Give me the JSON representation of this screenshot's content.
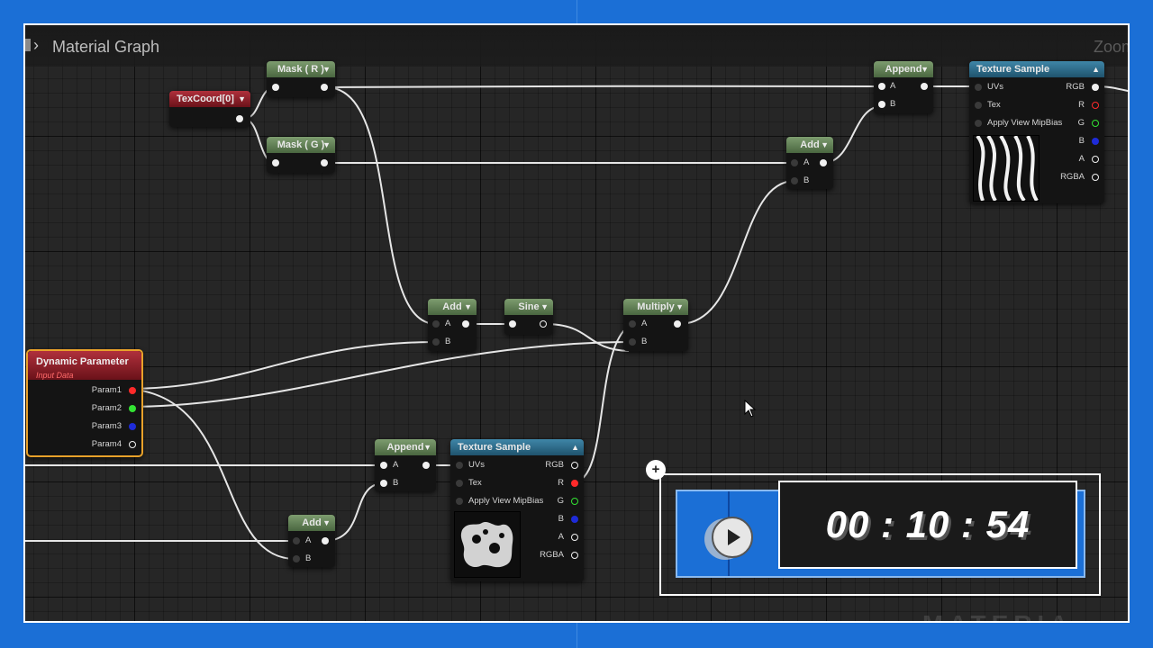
{
  "breadcrumb": {
    "cut_label": "",
    "title": "Material Graph"
  },
  "zoom_label": "Zoom",
  "nodes": {
    "texcoord": {
      "title": "TexCoord[0]"
    },
    "mask_r": {
      "title": "Mask ( R )"
    },
    "mask_g": {
      "title": "Mask ( G )"
    },
    "append_top": {
      "title": "Append",
      "pin_a": "A",
      "pin_b": "B"
    },
    "add_top": {
      "title": "Add",
      "pin_a": "A",
      "pin_b": "B"
    },
    "texture_top": {
      "title": "Texture Sample",
      "inputs": [
        "UVs",
        "Tex",
        "Apply View MipBias"
      ],
      "outputs": [
        "RGB",
        "R",
        "G",
        "B",
        "A",
        "RGBA"
      ]
    },
    "add_mid": {
      "title": "Add",
      "pin_a": "A",
      "pin_b": "B"
    },
    "sine": {
      "title": "Sine"
    },
    "multiply": {
      "title": "Multiply",
      "pin_a": "A",
      "pin_b": "B"
    },
    "dynamic": {
      "title": "Dynamic Parameter",
      "subtitle": "Input Data",
      "outputs": [
        "Param1",
        "Param2",
        "Param3",
        "Param4"
      ]
    },
    "append_bottom": {
      "title": "Append",
      "pin_a": "A",
      "pin_b": "B"
    },
    "texture_bottom": {
      "title": "Texture Sample",
      "inputs": [
        "UVs",
        "Tex",
        "Apply View MipBias"
      ],
      "outputs": [
        "RGB",
        "R",
        "G",
        "B",
        "A",
        "RGBA"
      ]
    },
    "add_bottom": {
      "title": "Add",
      "pin_a": "A",
      "pin_b": "B"
    }
  },
  "timer": {
    "time": "00 : 10 : 54",
    "plus": "+"
  },
  "watermark": "MATERIA",
  "colors": {
    "frame_blue": "#1b6fd6",
    "node_green": "#5f7e52",
    "node_blue": "#2a6a8c",
    "node_red": "#8e1f29",
    "dynamic_border": "#e8a12a"
  }
}
